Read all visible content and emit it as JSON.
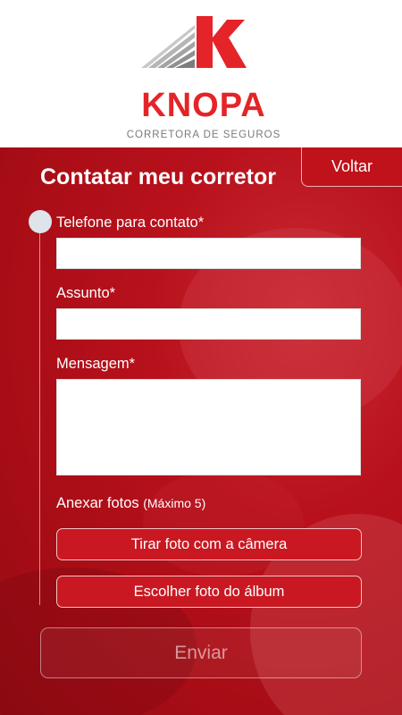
{
  "brand": {
    "name": "KNOPA",
    "tagline": "CORRETORA DE SEGUROS",
    "colors": {
      "primary": "#e42428",
      "logo_gray": "#9a9a9a",
      "panel_red": "#b8111c"
    }
  },
  "header": {
    "back_label": "Voltar",
    "title": "Contatar meu corretor"
  },
  "form": {
    "phone": {
      "label": "Telefone para contato*",
      "value": ""
    },
    "subject": {
      "label": "Assunto*",
      "value": ""
    },
    "message": {
      "label": "Mensagem*",
      "value": ""
    },
    "attach": {
      "label": "Anexar fotos",
      "limit": "(Máximo 5)",
      "camera_label": "Tirar foto com a câmera",
      "album_label": "Escolher foto do álbum"
    },
    "submit_label": "Enviar"
  }
}
